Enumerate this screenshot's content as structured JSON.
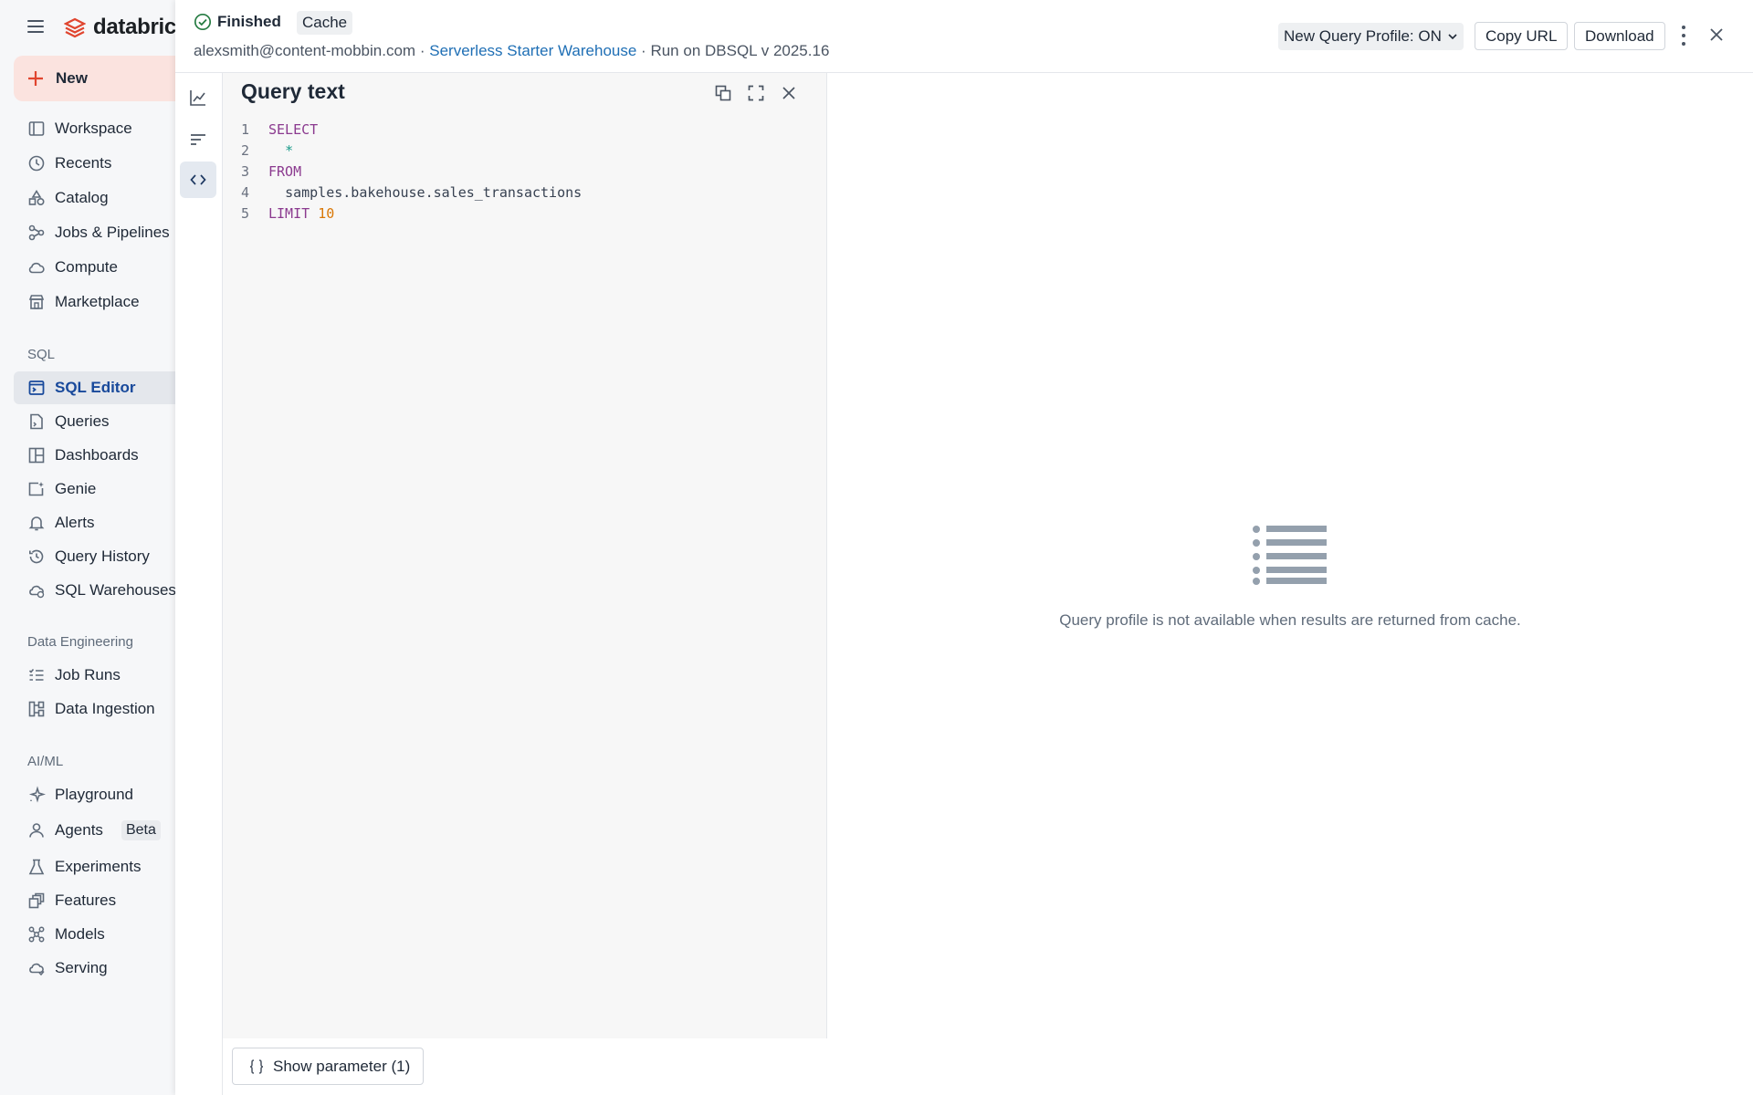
{
  "sidebar": {
    "brand": "databricks",
    "new_label": "New",
    "items_top": [
      {
        "label": "Workspace"
      },
      {
        "label": "Recents"
      },
      {
        "label": "Catalog"
      },
      {
        "label": "Jobs & Pipelines"
      },
      {
        "label": "Compute"
      },
      {
        "label": "Marketplace"
      }
    ],
    "section_sql": "SQL",
    "items_sql": [
      {
        "label": "SQL Editor"
      },
      {
        "label": "Queries"
      },
      {
        "label": "Dashboards"
      },
      {
        "label": "Genie"
      },
      {
        "label": "Alerts"
      },
      {
        "label": "Query History"
      },
      {
        "label": "SQL Warehouses"
      }
    ],
    "section_de": "Data Engineering",
    "items_de": [
      {
        "label": "Job Runs"
      },
      {
        "label": "Data Ingestion"
      }
    ],
    "section_ml": "AI/ML",
    "items_ml": [
      {
        "label": "Playground"
      },
      {
        "label": "Agents",
        "badge": "Beta"
      },
      {
        "label": "Experiments"
      },
      {
        "label": "Features"
      },
      {
        "label": "Models"
      },
      {
        "label": "Serving"
      }
    ]
  },
  "header": {
    "status": "Finished",
    "cache": "Cache",
    "user": "alexsmith@content-mobbin.com",
    "separator": "·",
    "warehouse": "Serverless Starter Warehouse",
    "run_info": "Run on DBSQL v 2025.16",
    "profile_toggle": "New Query Profile: ON",
    "copy_url": "Copy URL",
    "download": "Download"
  },
  "query_panel": {
    "title": "Query text",
    "lines": [
      "1",
      "2",
      "3",
      "4",
      "5"
    ],
    "code": {
      "select": "SELECT",
      "star": "*",
      "from": "FROM",
      "table": "samples.bakehouse.sales_transactions",
      "limit": "LIMIT",
      "limit_value": "10"
    },
    "show_parameter": "Show parameter (1)"
  },
  "empty_state": {
    "message": "Query profile is not available when results are returned from cache."
  }
}
